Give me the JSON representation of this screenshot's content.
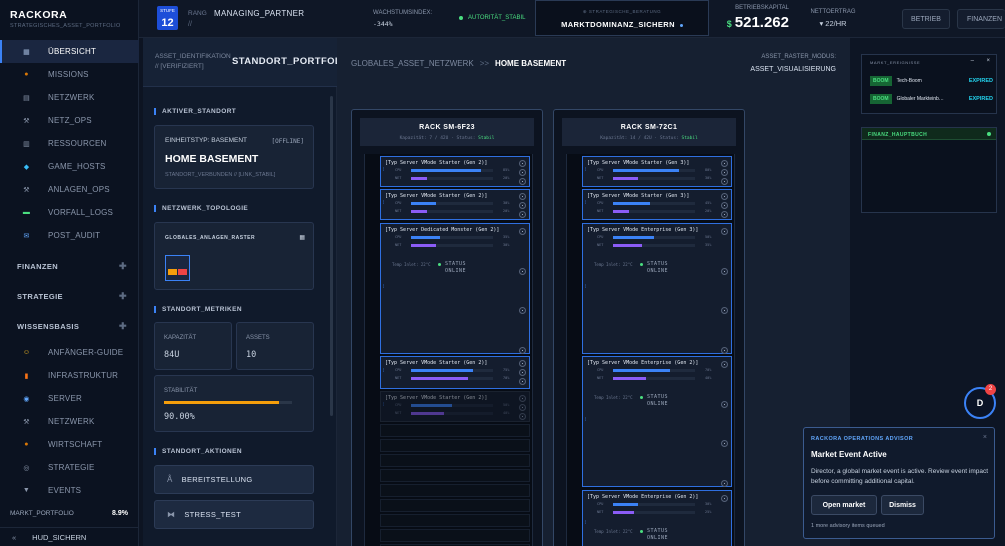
{
  "brand": {
    "title": "RACKORA",
    "subtitle": "STRATEGISCHES_ASSET_PORTFOLIO"
  },
  "nav": {
    "items": [
      {
        "label": "ÜBERSICHT",
        "icon": "grid-icon"
      },
      {
        "label": "MISSIONS",
        "icon": "medal-icon"
      },
      {
        "label": "NETZWERK",
        "icon": "network-icon"
      },
      {
        "label": "NETZ_OPS",
        "icon": "wrench-icon"
      },
      {
        "label": "RESSOURCEN",
        "icon": "stack-icon"
      },
      {
        "label": "GAME_HOSTS",
        "icon": "cube-icon"
      },
      {
        "label": "ANLAGEN_OPS",
        "icon": "tool-icon"
      },
      {
        "label": "VORFALL_LOGS",
        "icon": "log-icon"
      },
      {
        "label": "POST_AUDIT",
        "icon": "mail-icon"
      }
    ],
    "sections": [
      "FINANZEN",
      "STRATEGIE",
      "WISSENSBASIS"
    ],
    "wissen": [
      {
        "label": "ANFÄNGER-GUIDE",
        "icon": "smiley-icon"
      },
      {
        "label": "INFRASTRUKTUR",
        "icon": "building-icon"
      },
      {
        "label": "SERVER",
        "icon": "globe-icon"
      },
      {
        "label": "NETZWERK",
        "icon": "wrench-icon"
      },
      {
        "label": "WIRTSCHAFT",
        "icon": "moneybag-icon"
      },
      {
        "label": "STRATEGIE",
        "icon": "target-icon"
      },
      {
        "label": "EVENTS",
        "icon": "trophy-icon"
      }
    ],
    "market_label": "MARKT_PORTFOLIO",
    "market_value": "8.9%",
    "hud": "HUD_SICHERN"
  },
  "top": {
    "level_label": "STUFE",
    "level": "12",
    "rank_label": "RANG",
    "rank": "MANAGING_PARTNER",
    "rank_sub": "//",
    "growth_label": "WACHSTUMSINDEX:",
    "growth_value": "-344%",
    "authority": "AUTORITÄT_STABIL",
    "mission_label": "⊕ STRATEGISCHE_BERATUNG",
    "mission": "MARKTDOMINANZ_SICHERN",
    "capital_label": "BETRIEBSKAPITAL",
    "capital_currency": "$",
    "capital": "521.262",
    "net_label": "NETTOERTRAG",
    "net_value": "▾ 22/HR",
    "btn_betrieb": "BETRIEB",
    "btn_finanzen": "FINANZEN"
  },
  "standort": {
    "head_label": "ASSET_IDENTIFIKATION",
    "head_sub": "// [VERIFIZIERT]",
    "head_title": "STANDORT_PORTFOLIO",
    "sec_active": "AKTIVER_STANDORT",
    "type": "EINHEITSTYP: BASEMENT",
    "status": "[OFFLINE]",
    "name": "HOME BASEMENT",
    "connection": "STANDORT_VERBUNDEN // [LINK_STABIL]",
    "sec_topo": "NETZWERK_TOPOLOGIE",
    "topo_title": "GLOBALES_ANLAGEN_RASTER",
    "sec_metrics": "STANDORT_METRIKEN",
    "cap_label": "KAPAZITÄT",
    "cap": "84U",
    "assets_label": "ASSETS",
    "assets": "10",
    "stab_label": "STABILITÄT",
    "stab": "90.00%",
    "stab_fraction": 0.9,
    "sec_actions": "STANDORT_AKTIONEN",
    "act1": "BEREITSTELLUNG",
    "act2": "STRESS_TEST"
  },
  "main": {
    "bc1": "GLOBALES_ASSET_NETZWERK",
    "bc_sep": ">>",
    "bc2": "HOME BASEMENT",
    "mode_label": "ASSET_RASTER_MODUS:",
    "mode_value": "ASSET_VISUALISIERUNG"
  },
  "racks": [
    {
      "title": "RACK SM-6F23",
      "sub_a": "Kapazität: 7 / 42U · Status: ",
      "sub_b": "Stabil",
      "servers": [
        {
          "name": "[Typ Server VMode Starter (Gen 2)]",
          "cpu": 0.85,
          "net": 0.2
        },
        {
          "name": "[Typ Server VMode Starter (Gen 2)]",
          "cpu": 0.3,
          "net": 0.2
        },
        {
          "name": "[Typ Server Dedicated Monster (Gen 2)]",
          "cpu": 0.35,
          "net": 0.3,
          "temp": "Temp Inlet: 22°C",
          "status": "STATUS ONLINE"
        },
        {
          "name": "[Typ Server VMode Starter (Gen 2)]",
          "cpu": 0.75,
          "net": 0.7
        },
        {
          "name": "[Typ Server VMode Starter (Gen 2)]",
          "cpu": 0.5,
          "net": 0.4
        }
      ]
    },
    {
      "title": "RACK SM-72C1",
      "sub_a": "Kapazität: 14 / 42U · Status: ",
      "sub_b": "Stabil",
      "servers": [
        {
          "name": "[Typ Server VMode Starter (Gen 3)]",
          "cpu": 0.8,
          "net": 0.3
        },
        {
          "name": "[Typ Server VMode Starter (Gen 3)]",
          "cpu": 0.45,
          "net": 0.2
        },
        {
          "name": "[Typ Server VMode Enterprise (Gen 3)]",
          "cpu": 0.5,
          "net": 0.35,
          "temp": "Temp Inlet: 22°C",
          "status": "STATUS ONLINE"
        },
        {
          "name": "[Typ Server VMode Enterprise (Gen 2)]",
          "cpu": 0.7,
          "net": 0.4,
          "temp": "Temp Inlet: 22°C",
          "status": "STATUS ONLINE"
        },
        {
          "name": "[Typ Server VMode Enterprise (Gen 2)]",
          "cpu": 0.3,
          "net": 0.25,
          "temp": "Temp Inlet: 22°C",
          "status": "STATUS ONLINE"
        }
      ]
    }
  ],
  "events": {
    "title": "MARKT_EREIGNISSE",
    "rows": [
      {
        "tag": "BOOM",
        "name": "Tech-Boom",
        "status": "EXPIRED"
      },
      {
        "tag": "BOOM",
        "name": "Globaler Markteinb…",
        "status": "EXPIRED"
      }
    ],
    "ledger": "FINANZ_HAUPTBUCH"
  },
  "avatar": {
    "letter": "D",
    "badge": "2"
  },
  "advisor": {
    "header": "RACKORA OPERATIONS ADVISOR",
    "title": "Market Event Active",
    "body": "Director, a global market event is active. Review event impact before committing additional capital.",
    "btn_open": "Open market",
    "btn_dismiss": "Dismiss",
    "queue": "1 more advisory items queued"
  },
  "colors": {
    "accent": "#3b82f6",
    "ok": "#4ade80",
    "warn": "#f59e0b",
    "alert": "#ef4444"
  }
}
